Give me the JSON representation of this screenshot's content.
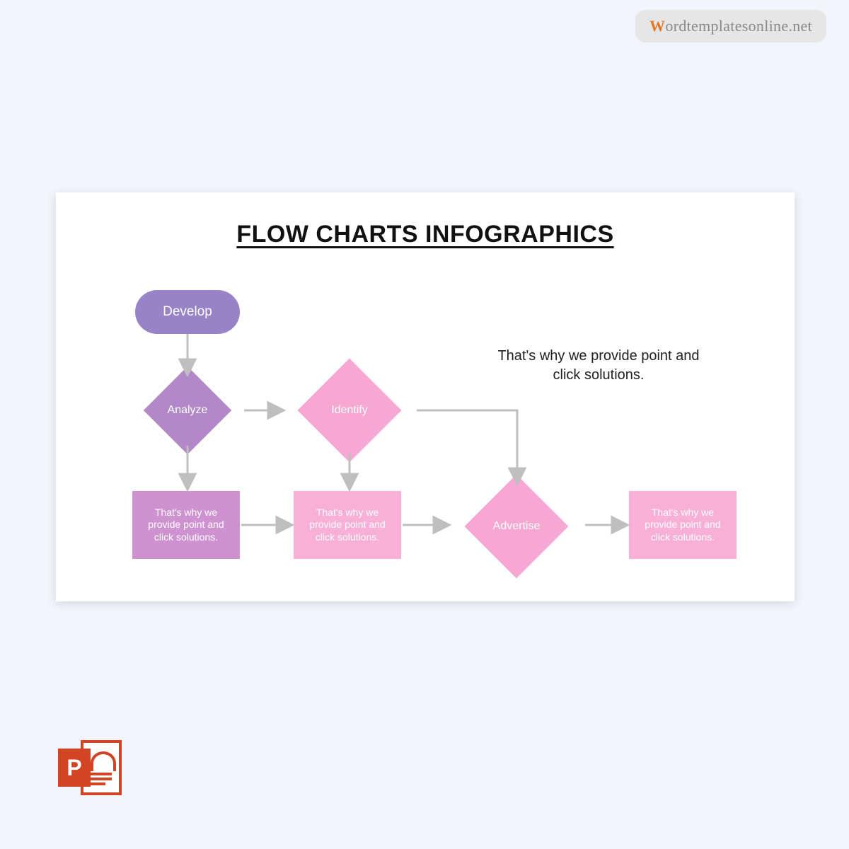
{
  "watermark": {
    "initial": "W",
    "rest": "ordtemplatesonline.net"
  },
  "slide": {
    "title": "FLOW CHARTS INFOGRAPHICS",
    "sidenote": "That's why we provide point and click solutions.",
    "nodes": {
      "develop": "Develop",
      "analyze": "Analyze",
      "identify": "Identify",
      "advertise": "Advertise",
      "box1": "That's why we provide point and click solutions.",
      "box2": "That's why we provide point and click solutions.",
      "box3": "That's why we provide point and click solutions."
    }
  },
  "icon": {
    "ppt_letter": "P"
  }
}
